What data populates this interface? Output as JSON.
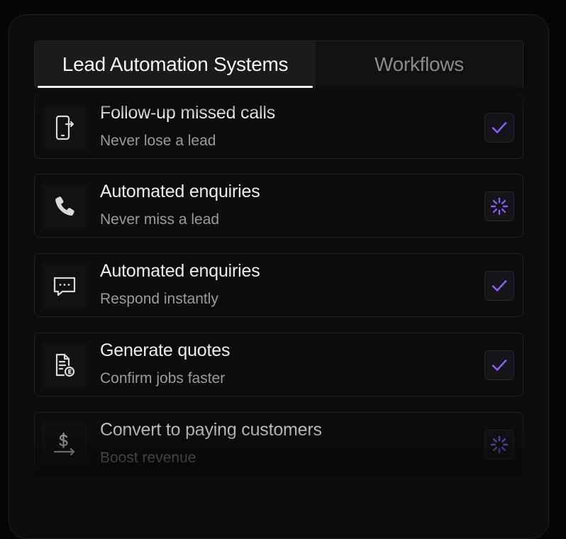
{
  "tabs": [
    {
      "label": "Lead Automation Systems",
      "active": true
    },
    {
      "label": "Workflows",
      "active": false
    }
  ],
  "items": [
    {
      "title": "Follow-up missed calls",
      "subtitle": "Never lose a lead",
      "icon": "phone-forward-icon",
      "status": "done"
    },
    {
      "title": "Automated enquiries",
      "subtitle": "Never miss a lead",
      "icon": "phone-icon",
      "status": "loading"
    },
    {
      "title": "Automated enquiries",
      "subtitle": "Respond instantly",
      "icon": "chat-icon",
      "status": "done"
    },
    {
      "title": "Generate quotes",
      "subtitle": "Confirm jobs faster",
      "icon": "quote-document-icon",
      "status": "done"
    },
    {
      "title": "Convert to paying customers",
      "subtitle": "Boost revenue",
      "icon": "dollar-arrow-icon",
      "status": "loading"
    }
  ],
  "colors": {
    "accent": "#8b5cf6",
    "background": "#050505",
    "panel": "#0c0c0c"
  }
}
